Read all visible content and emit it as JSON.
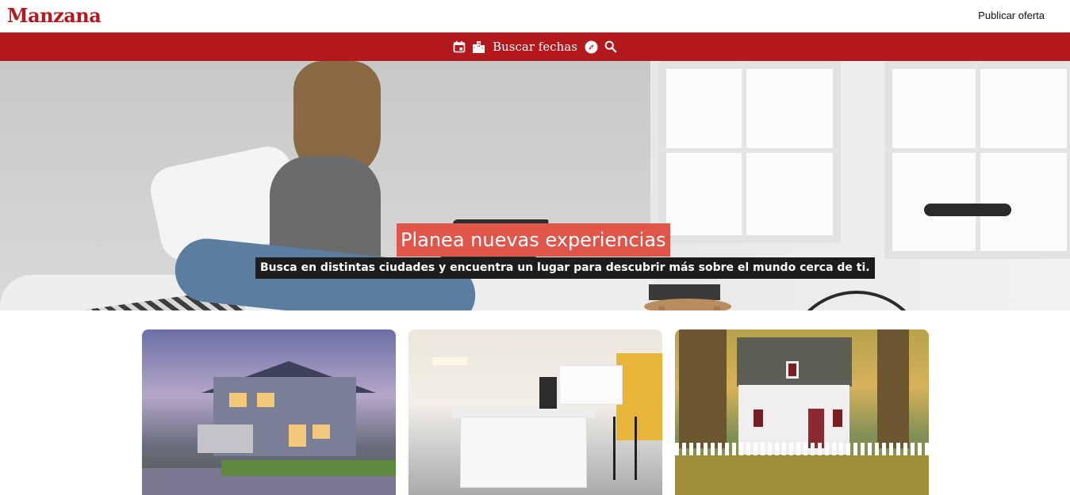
{
  "header": {
    "logo": "Manzana",
    "publish_link": "Publicar oferta"
  },
  "searchbar": {
    "label": "Buscar fechas",
    "icons": [
      "calendar-icon",
      "city-icon",
      "compass-icon",
      "search-icon"
    ]
  },
  "hero": {
    "title": "Planea nuevas experiencias",
    "subtitle": "Busca en distintas ciudades y encuentra un lugar para descubrir más sobre el mundo cerca de ti."
  },
  "cards": [
    {
      "image": "house-dusk-photo"
    },
    {
      "image": "modern-kitchen-photo"
    },
    {
      "image": "white-house-autumn-photo"
    }
  ],
  "colors": {
    "brand": "#b3191c",
    "title_bg": "#e0564a",
    "subtitle_bg": "#1d1d1d"
  }
}
